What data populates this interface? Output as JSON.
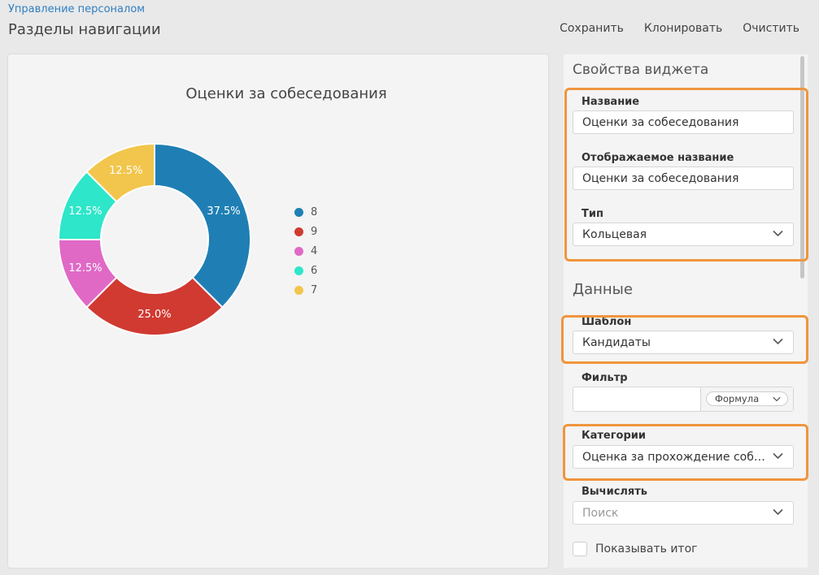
{
  "header": {
    "breadcrumb": "Управление персоналом",
    "title": "Разделы навигации",
    "actions": {
      "save": "Сохранить",
      "clone": "Клонировать",
      "clear": "Очистить"
    }
  },
  "chart_data": {
    "type": "pie",
    "title": "Оценки за собеседования",
    "categories": [
      "8",
      "9",
      "4",
      "6",
      "7"
    ],
    "values": [
      37.5,
      25.0,
      12.5,
      12.5,
      12.5
    ],
    "labels": [
      "37.5%",
      "25.0%",
      "12.5%",
      "12.5%",
      "12.5%"
    ],
    "colors": [
      "#1f7fb4",
      "#d03a31",
      "#e069c6",
      "#2ee6c9",
      "#f2c64c"
    ],
    "donut": true,
    "legend": "right"
  },
  "panel": {
    "widget_props_title": "Свойства виджета",
    "name_label": "Название",
    "name_value": "Оценки за собеседования",
    "display_name_label": "Отображаемое название",
    "display_name_value": "Оценки за собеседования",
    "type_label": "Тип",
    "type_value": "Кольцевая",
    "data_title": "Данные",
    "template_label": "Шаблон",
    "template_value": "Кандидаты",
    "filter_label": "Фильтр",
    "filter_value": "",
    "formula_label": "Формула",
    "categories_label": "Категории",
    "categories_value": "Оценка за прохождение собеседования",
    "compute_label": "Вычислять",
    "compute_placeholder": "Поиск",
    "show_total_label": "Показывать итог",
    "show_total_checked": false
  },
  "highlight_color": "#f0953d"
}
